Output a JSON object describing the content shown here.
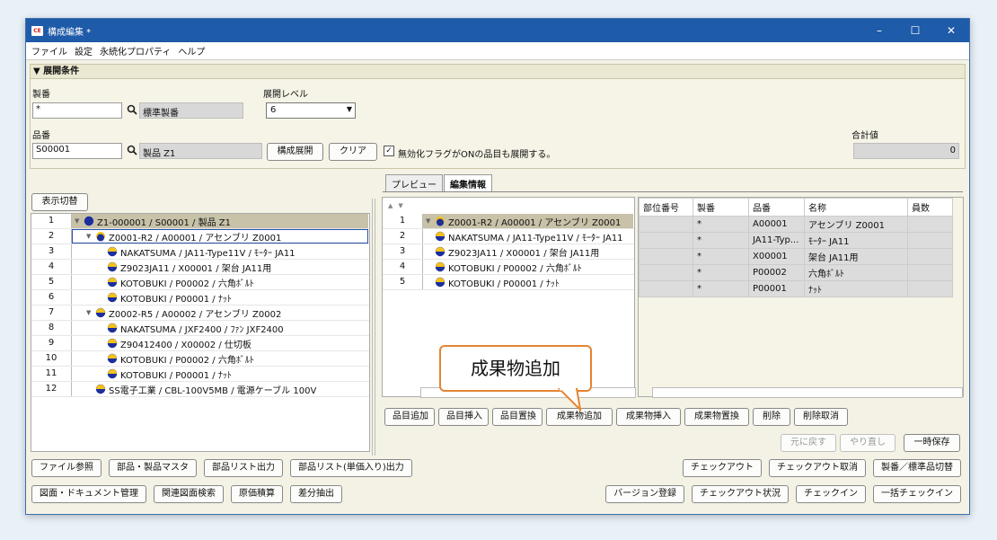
{
  "window": {
    "title": "構成編集 *",
    "icon_text": "CE"
  },
  "winctrls": {
    "minimize": "–",
    "maximize": "☐",
    "close": "✕"
  },
  "menu": [
    "ファイル",
    "設定",
    "永続化プロパティ",
    "ヘルプ"
  ],
  "conditions": {
    "header": "▼ 展開条件",
    "seiban_label": "製番",
    "seiban_value": "*",
    "seiban_display": "標準製番",
    "level_label": "展開レベル",
    "level_value": "6",
    "hinban_label": "品番",
    "hinban_value": "S00001",
    "hinban_display": "製品 Z1",
    "expand_button": "構成展開",
    "clear_button": "クリア",
    "checkbox_checked": true,
    "checkbox_mark": "✓",
    "checkbox_label": "無効化フラグがONの品目も展開する。",
    "total_label": "合計値",
    "total_value": "0"
  },
  "left": {
    "toggle_button": "表示切替",
    "rows": [
      {
        "num": "1",
        "indent": 0,
        "tri": "▼",
        "icon": "assembly",
        "text": "Z1-000001 / S00001 / 製品 Z1",
        "sel": true
      },
      {
        "num": "2",
        "indent": 1,
        "tri": "▼",
        "icon": "folder-part",
        "text": "Z0001-R2 / A00001 / アセンブリ Z0001",
        "focus": true
      },
      {
        "num": "3",
        "indent": 2,
        "tri": "",
        "icon": "part",
        "text": "NAKATSUMA / JA11-Type11V / ﾓｰﾀｰ JA11"
      },
      {
        "num": "4",
        "indent": 2,
        "tri": "",
        "icon": "part",
        "text": "Z9023JA11 / X00001 / 架台 JA11用"
      },
      {
        "num": "5",
        "indent": 2,
        "tri": "",
        "icon": "part",
        "text": "KOTOBUKI / P00002 / 六角ﾎﾞﾙﾄ"
      },
      {
        "num": "6",
        "indent": 2,
        "tri": "",
        "icon": "part",
        "text": "KOTOBUKI / P00001 / ﾅｯﾄ"
      },
      {
        "num": "7",
        "indent": 1,
        "tri": "▼",
        "icon": "part",
        "text": "Z0002-R5 / A00002 / アセンブリ Z0002"
      },
      {
        "num": "8",
        "indent": 2,
        "tri": "",
        "icon": "part",
        "text": "NAKATSUMA / JXF2400 / ﾌｧﾝ JXF2400"
      },
      {
        "num": "9",
        "indent": 2,
        "tri": "",
        "icon": "part",
        "text": "Z90412400 / X00002 / 仕切板"
      },
      {
        "num": "10",
        "indent": 2,
        "tri": "",
        "icon": "part",
        "text": "KOTOBUKI / P00002 / 六角ﾎﾞﾙﾄ"
      },
      {
        "num": "11",
        "indent": 2,
        "tri": "",
        "icon": "part",
        "text": "KOTOBUKI / P00001 / ﾅｯﾄ"
      },
      {
        "num": "12",
        "indent": 1,
        "tri": "",
        "icon": "part",
        "text": "SS電子工業 / CBL-100V5MB / 電源ケーブル 100V"
      }
    ]
  },
  "right": {
    "tabs": [
      "プレビュー",
      "編集情報"
    ],
    "active_tab": 1,
    "sort_up": "▲",
    "sort_down": "▼",
    "rows": [
      {
        "num": "1",
        "tri": "▼",
        "icon": "folder-part",
        "text": "Z0001-R2 / A00001 / アセンブリ Z0001",
        "sel": true
      },
      {
        "num": "2",
        "tri": "",
        "icon": "part",
        "text": "NAKATSUMA / JA11-Type11V / ﾓｰﾀｰ JA11"
      },
      {
        "num": "3",
        "tri": "",
        "icon": "part",
        "text": "Z9023JA11 / X00001 / 架台 JA11用"
      },
      {
        "num": "4",
        "tri": "",
        "icon": "part",
        "text": "KOTOBUKI / P00002 / 六角ﾎﾞﾙﾄ"
      },
      {
        "num": "5",
        "tri": "",
        "icon": "part",
        "text": "KOTOBUKI / P00001 / ﾅｯﾄ"
      }
    ],
    "grid_headers": [
      "部位番号",
      "製番",
      "品番",
      "名称",
      "員数"
    ],
    "grid_rows": [
      [
        "",
        "*",
        "A00001",
        "アセンブリ Z0001",
        ""
      ],
      [
        "",
        "*",
        "JA11-Typ...",
        "ﾓｰﾀｰ JA11",
        ""
      ],
      [
        "",
        "*",
        "X00001",
        "架台 JA11用",
        ""
      ],
      [
        "",
        "*",
        "P00002",
        "六角ﾎﾞﾙﾄ",
        ""
      ],
      [
        "",
        "*",
        "P00001",
        "ﾅｯﾄ",
        ""
      ]
    ],
    "actions": [
      "品目追加",
      "品目挿入",
      "品目置換",
      "成果物追加",
      "成果物挿入",
      "成果物置換",
      "削除",
      "削除取消"
    ],
    "undo": "元に戻す",
    "redo": "やり直し",
    "temp_save": "一時保存"
  },
  "callout": "成果物追加",
  "bottom_left_row1": [
    "ファイル参照",
    "部品・製品マスタ",
    "部品リスト出力",
    "部品リスト(単価入り)出力"
  ],
  "bottom_left_row2": [
    "図面・ドキュメント管理",
    "関連図面検索",
    "原価積算",
    "差分抽出"
  ],
  "bottom_right_row1": [
    "チェックアウト",
    "チェックアウト取消",
    "製番／標準品切替"
  ],
  "bottom_right_row2": [
    "バージョン登録",
    "チェックアウト状況",
    "チェックイン",
    "一括チェックイン"
  ],
  "colors": {
    "titlebar": "#1e5ba8",
    "callout_border": "#e48433",
    "selected_row": "#c7c2a8",
    "part_icon_blue": "#1c2f9c",
    "part_icon_yellow": "#f3c21a"
  }
}
